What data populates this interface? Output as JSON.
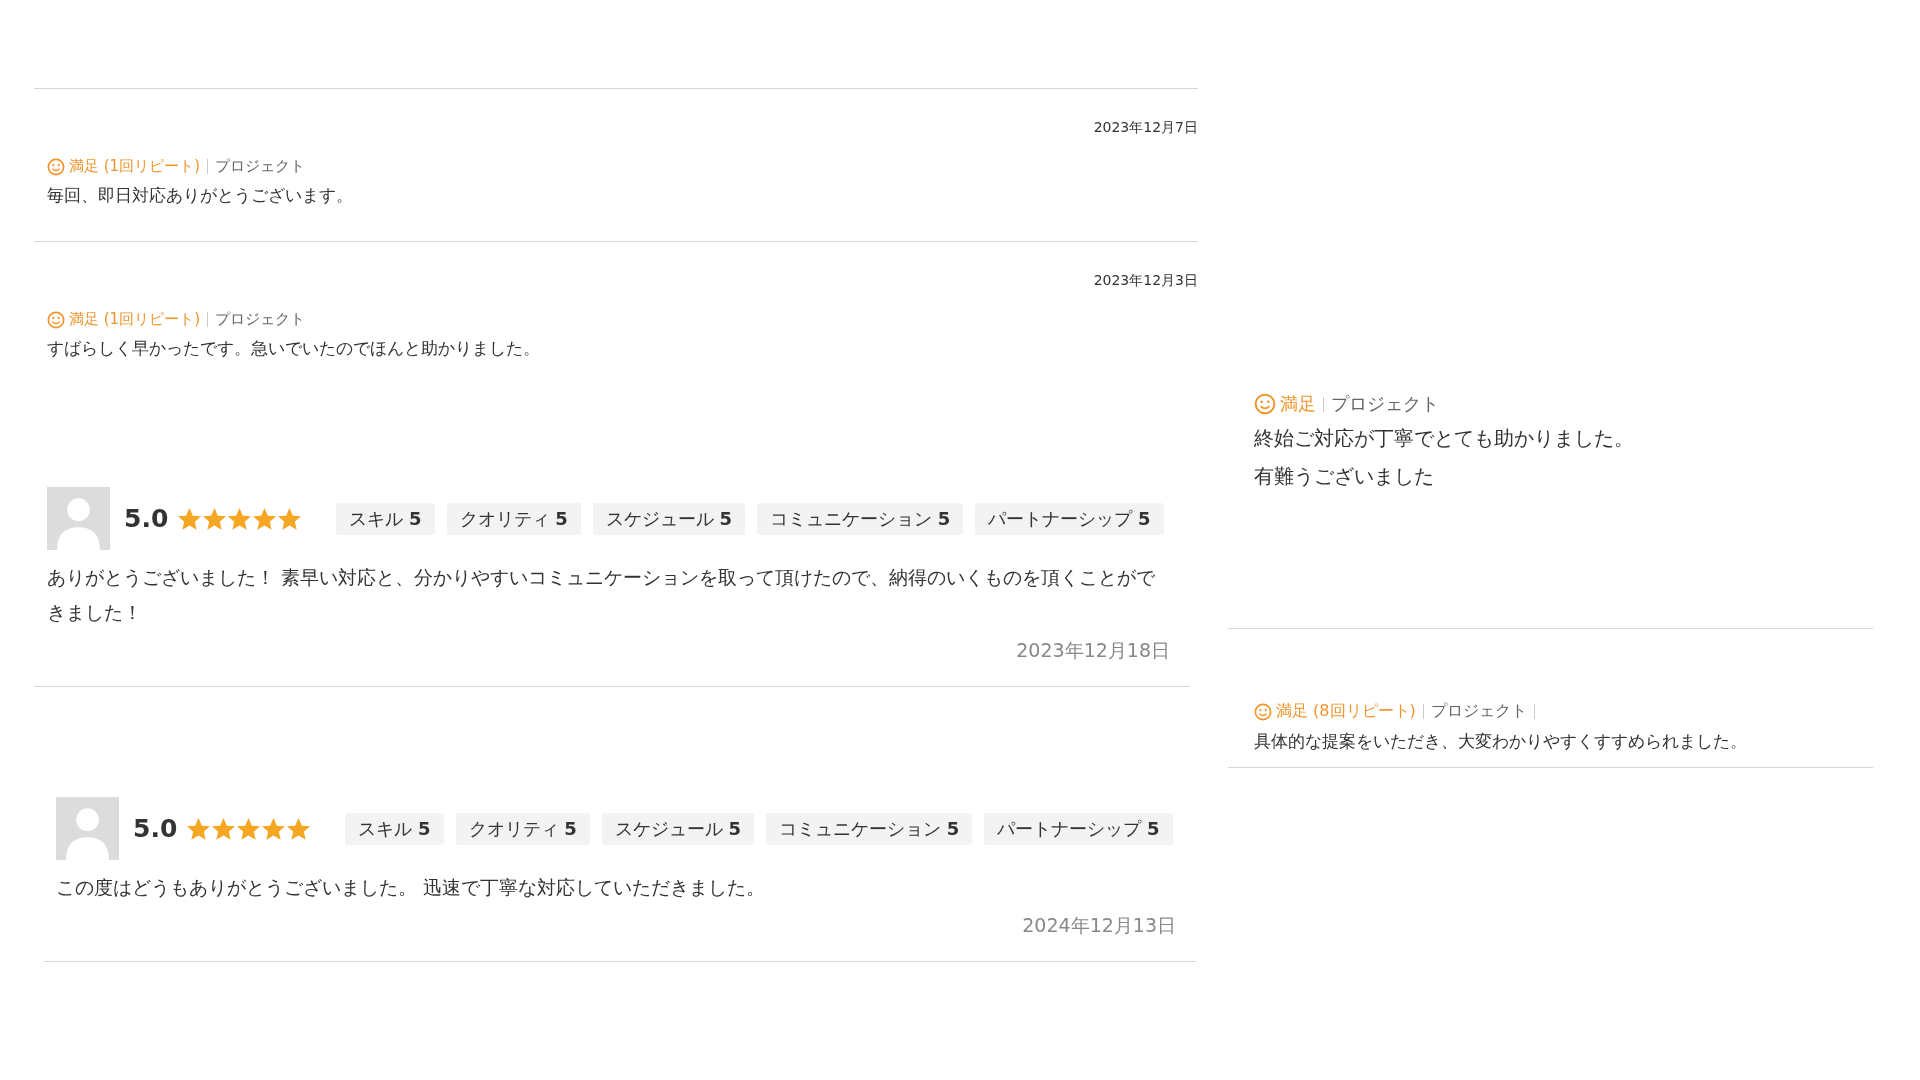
{
  "left_reviews": [
    {
      "kind": "simple",
      "date": "2023年12月7日",
      "satisfaction": "満足",
      "repeat": "(1回リピート)",
      "category": "プロジェクト",
      "text": "毎回、即日対応ありがとうございます。"
    },
    {
      "kind": "simple",
      "date": "2023年12月3日",
      "satisfaction": "満足",
      "repeat": "(1回リピート)",
      "category": "プロジェクト",
      "text": "すばらしく早かったです。急いでいたのでほんと助かりました。"
    },
    {
      "kind": "rated",
      "score": "5.0",
      "stars": 5,
      "tags": [
        {
          "label": "スキル",
          "value": "5"
        },
        {
          "label": "クオリティ",
          "value": "5"
        },
        {
          "label": "スケジュール",
          "value": "5"
        },
        {
          "label": "コミュニケーション",
          "value": "5"
        },
        {
          "label": "パートナーシップ",
          "value": "5"
        }
      ],
      "text": "ありがとうございました！ 素早い対応と、分かりやすいコミュニケーションを取って頂けたので、納得のいくものを頂くことができました！",
      "date": "2023年12月18日"
    },
    {
      "kind": "rated",
      "score": "5.0",
      "stars": 5,
      "tags": [
        {
          "label": "スキル",
          "value": "5"
        },
        {
          "label": "クオリティ",
          "value": "5"
        },
        {
          "label": "スケジュール",
          "value": "5"
        },
        {
          "label": "コミュニケーション",
          "value": "5"
        },
        {
          "label": "パートナーシップ",
          "value": "5"
        }
      ],
      "text": "この度はどうもありがとうございました。 迅速で丁寧な対応していただきました。",
      "date": "2024年12月13日"
    }
  ],
  "right_reviews": [
    {
      "kind": "simple",
      "satisfaction": "満足",
      "category": "プロジェクト",
      "lines": [
        "終始ご対応が丁寧でとても助かりました。",
        "有難うございました"
      ]
    },
    {
      "kind": "simple",
      "satisfaction": "満足",
      "repeat": "(8回リピート)",
      "category": "プロジェクト",
      "lines": [
        "具体的な提案をいただき、大変わかりやすくすすめられました。"
      ]
    }
  ]
}
